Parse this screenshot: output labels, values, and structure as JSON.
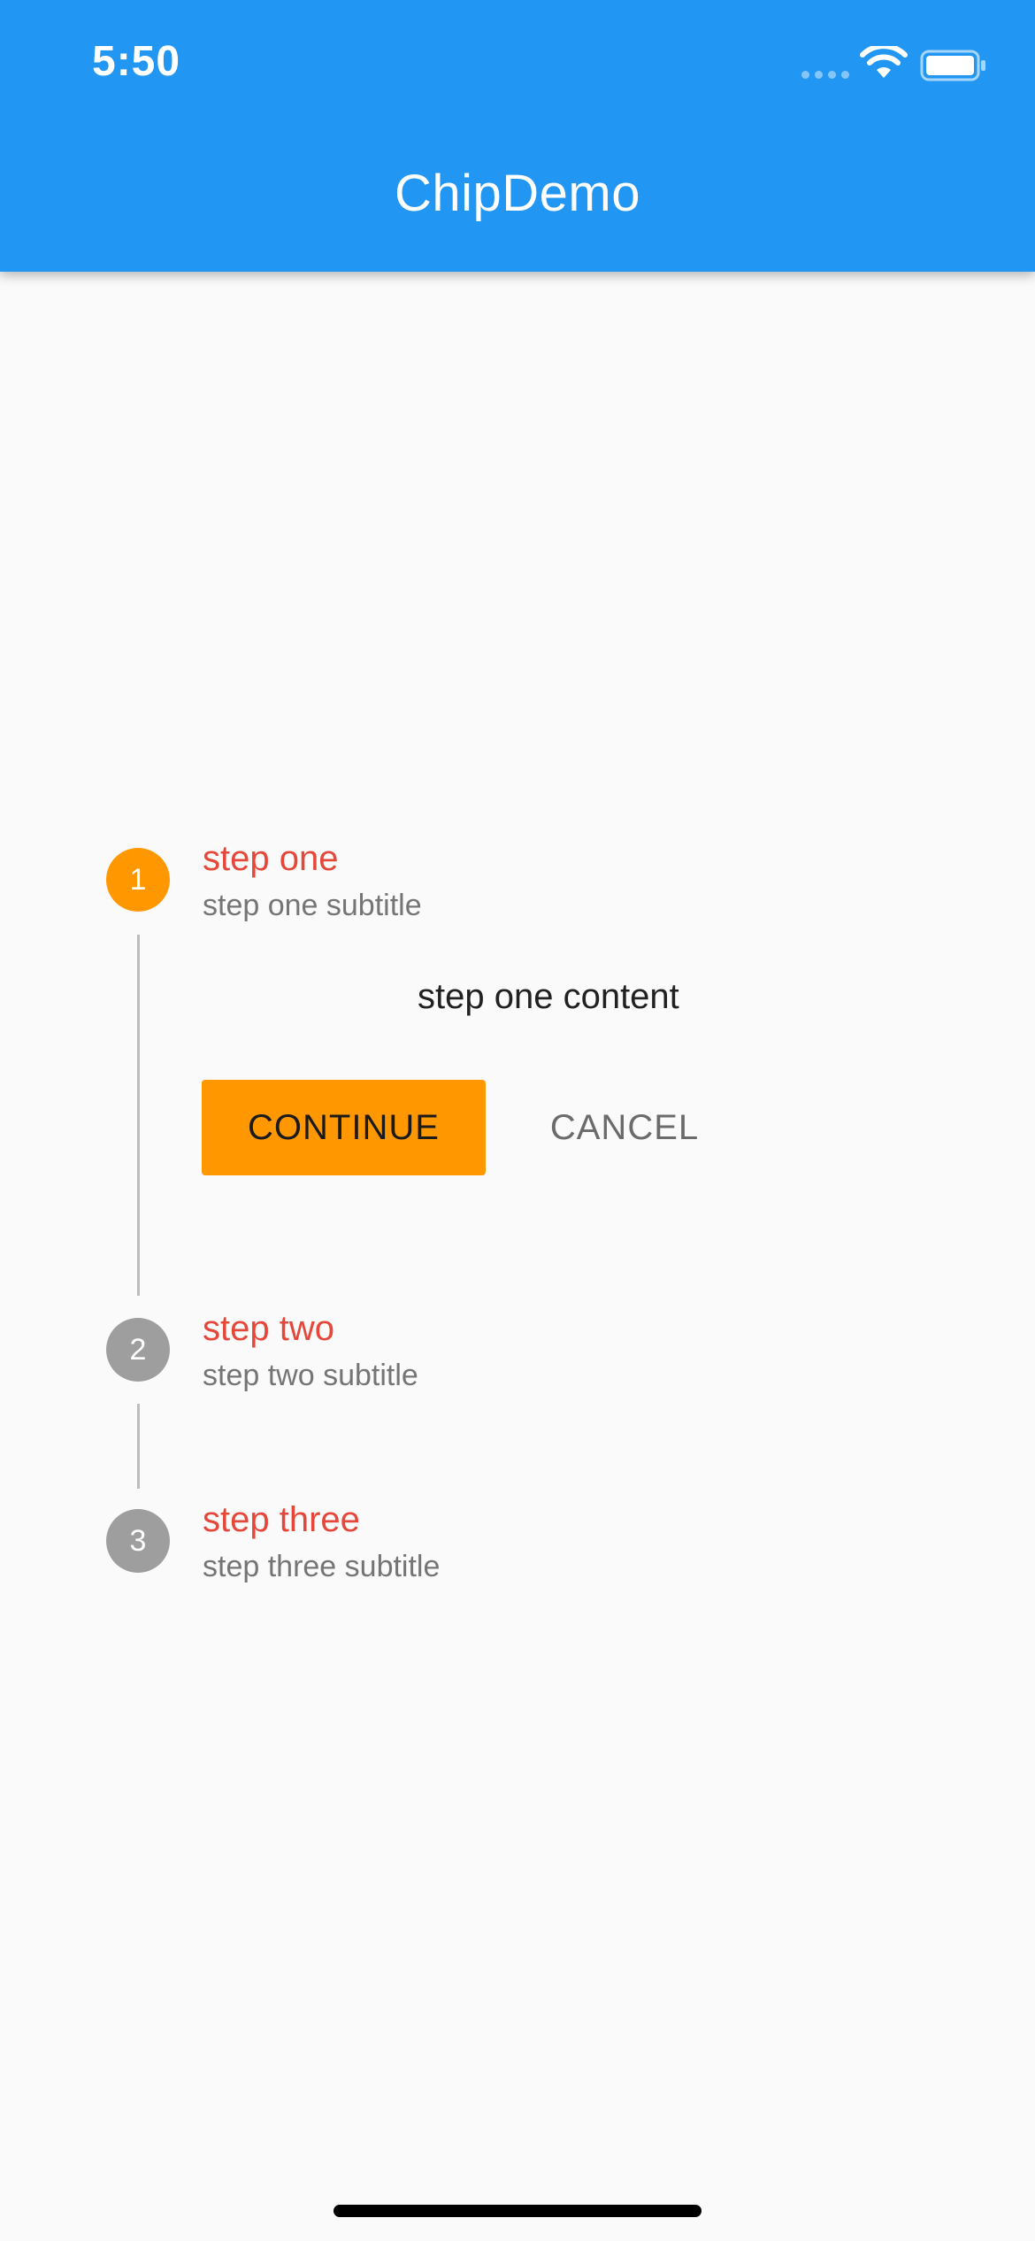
{
  "status_bar": {
    "time": "5:50"
  },
  "app_bar": {
    "title": "ChipDemo"
  },
  "stepper": {
    "steps": [
      {
        "number": "1",
        "title": "step one",
        "subtitle": "step one subtitle",
        "state": "active",
        "content": "step one content"
      },
      {
        "number": "2",
        "title": "step two",
        "subtitle": "step two subtitle",
        "state": "inactive"
      },
      {
        "number": "3",
        "title": "step three",
        "subtitle": "step three subtitle",
        "state": "inactive"
      }
    ],
    "controls": {
      "continue_label": "CONTINUE",
      "cancel_label": "CANCEL"
    }
  },
  "colors": {
    "app_bar": "#2196F3",
    "active_step": "#FF9800",
    "inactive_step": "#9E9E9E",
    "step_title": "#E5473A",
    "background": "#FAFAFA"
  },
  "icons": [
    "signal-icon",
    "wifi-icon",
    "battery-icon"
  ]
}
